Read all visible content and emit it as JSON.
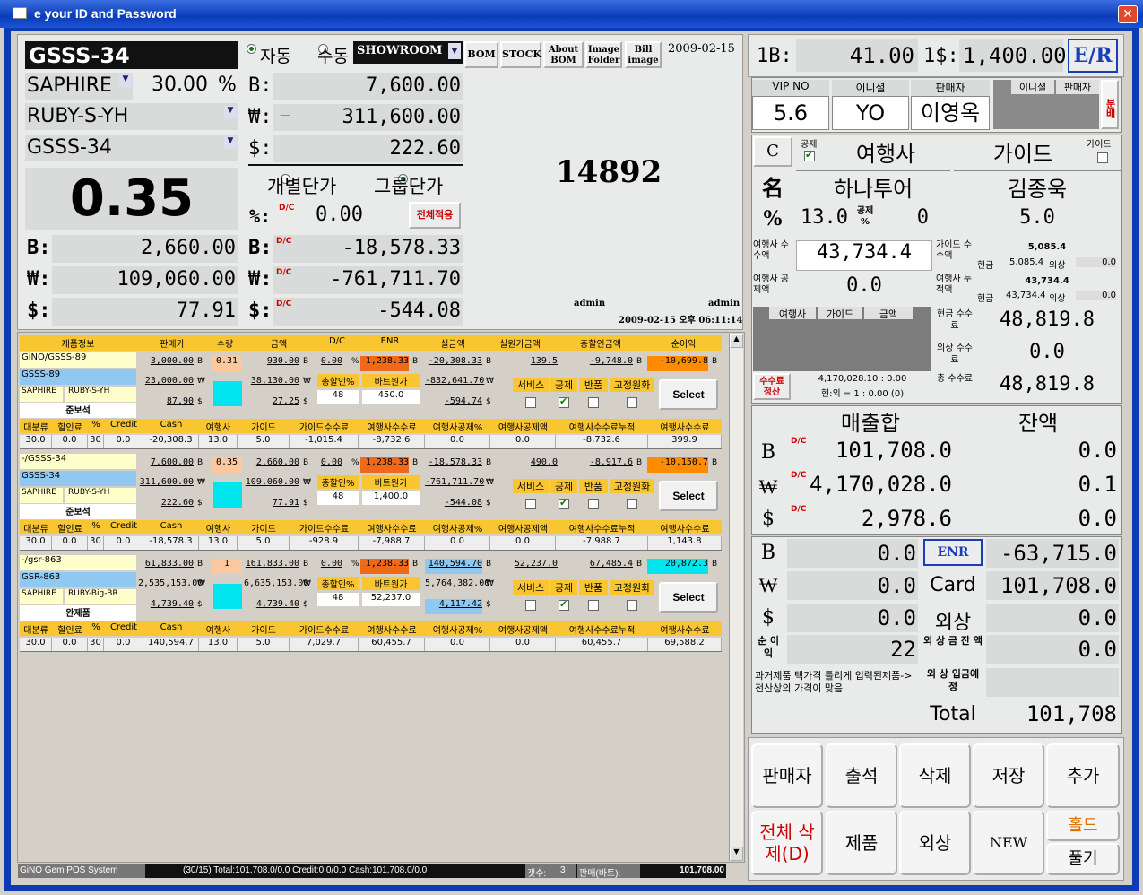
{
  "window": {
    "title": "e your ID and Password",
    "close": "✕"
  },
  "product": {
    "code": "GSSS-34",
    "mode_auto": "자동",
    "mode_manual": "수동",
    "showroom": "SHOWROOM",
    "btn_bom": "BOM",
    "btn_stock": "STOCK",
    "btn_about": "About BOM",
    "btn_image_folder": "Image Folder",
    "btn_bill_image": "Bill image",
    "date": "2009-02-15",
    "stone": "SAPHIRE",
    "pct": "30.00",
    "pct_sign": "%",
    "model": "RUBY-S-YH",
    "code2": "GSSS-34",
    "b_label": "B:",
    "w_label": "₩:",
    "d_label": "$:",
    "price_b": "7,600.00",
    "price_w_prefix": "—",
    "price_w": "311,600.00",
    "price_d": "222.60",
    "big_rate": "0.35",
    "individual": "개별단가",
    "group": "그룹단가",
    "pct_label": "%:",
    "dc": "D/C",
    "dc_value": "0.00",
    "apply_all": "전체적용",
    "big_id": "14892",
    "sub_b": "2,660.00",
    "sub_w": "109,060.00",
    "sub_d": "77.91",
    "dc_b": "-18,578.33",
    "dc_w": "-761,711.70",
    "dc_d": "-544.08",
    "admin1": "admin",
    "admin2": "admin",
    "timestamp": "2009-02-15 오후 06:11:14"
  },
  "table": {
    "headers": [
      "제품정보",
      "판매가",
      "수량",
      "금액",
      "D/C",
      "ENR",
      "실금액",
      "실원가금액",
      "총할인금액",
      "순이익"
    ],
    "sub_headers": [
      "대분류",
      "할인료",
      "%",
      "Credit",
      "Cash",
      "여행사",
      "가이드",
      "가이드수수료",
      "여행사수수료",
      "여행사공제%",
      "여행사공제액",
      "여행사수수료누적",
      "여행사수수료"
    ],
    "flags": [
      "서비스",
      "공제",
      "반품",
      "고정원화"
    ],
    "disc_label": "총할인%",
    "bath_label": "바트원가",
    "select": "Select",
    "items": [
      {
        "name": "GiNO/GSSS-89",
        "code": "GSSS-89",
        "stone": "SAPHIRE",
        "model": "RUBY-S-YH",
        "type": "준보석",
        "price_b": "3,000.00",
        "price_w": "23,000.00",
        "price_d": "87.90",
        "qty": "0.31",
        "amt_b": "930.00",
        "amt_w": "38,130.00",
        "amt_d": "27.25",
        "dc": "0.00",
        "enr": "1,238.33",
        "disc": "48",
        "bath": "450.0",
        "real_b": "-20,308.33",
        "real_w": "-832,641.70",
        "real_d": "-594.74",
        "cost": "139.5",
        "total_disc": "-9,748.0",
        "profit": "-10,699.8",
        "sub": [
          "30.0",
          "0.0",
          "30",
          "0.0",
          "-20,308.3",
          "13.0",
          "5.0",
          "-1,015.4",
          "-8,732.6",
          "0.0",
          "0.0",
          "-8,732.6",
          "399.9"
        ]
      },
      {
        "name": "-/GSSS-34",
        "code": "GSSS-34",
        "stone": "SAPHIRE",
        "model": "RUBY-S-YH",
        "type": "준보석",
        "price_b": "7,600.00",
        "price_w": "311,600.00",
        "price_d": "222.60",
        "qty": "0.35",
        "amt_b": "2,660.00",
        "amt_w": "109,060.00",
        "amt_d": "77.91",
        "dc": "0.00",
        "enr": "1,238.33",
        "disc": "48",
        "bath": "1,400.0",
        "real_b": "-18,578.33",
        "real_w": "-761,711.70",
        "real_d": "-544.08",
        "cost": "490.0",
        "total_disc": "-8,917.6",
        "profit": "-10,150.7",
        "sub": [
          "30.0",
          "0.0",
          "30",
          "0.0",
          "-18,578.3",
          "13.0",
          "5.0",
          "-928.9",
          "-7,988.7",
          "0.0",
          "0.0",
          "-7,988.7",
          "1,143.8"
        ]
      },
      {
        "name": "-/gsr-863",
        "code": "GSR-863",
        "stone": "SAPHIRE",
        "model": "RUBY-Big-BR",
        "type": "완제품",
        "price_b": "61,833.00",
        "price_w": "2,535,153.00",
        "price_d": "4,739.40",
        "qty": "1",
        "amt_b": "161,833.00",
        "amt_w": "6,635,153.00",
        "amt_d": "4,739.40",
        "dc": "0.00",
        "enr": "1,238.33",
        "disc": "48",
        "bath": "52,237.0",
        "real_b": "140,594.70",
        "real_w": "5,764,382.00",
        "real_d": "4,117.42",
        "cost": "52,237.0",
        "total_disc": "67,485.4",
        "profit": "20,872.3",
        "sub": [
          "30.0",
          "0.0",
          "30",
          "0.0",
          "140,594.7",
          "13.0",
          "5.0",
          "7,029.7",
          "60,455.7",
          "0.0",
          "0.0",
          "60,455.7",
          "69,588.2"
        ]
      }
    ]
  },
  "status": {
    "app": "GiNO Gem  POS System",
    "summary": "(30/15) Total:101,708.0/0.0 Credit:0.0/0.0 Cash:101,708.0/0.0",
    "count_label": "갯수:",
    "count": "3",
    "sales_label": "판매(바트):",
    "sales": "101,708.00"
  },
  "rate": {
    "b_label": "1B:",
    "b_value": "41.00",
    "d_label": "1$:",
    "d_value": "1,400.00",
    "er": "E/R"
  },
  "vip": {
    "vip_label": "VIP NO",
    "vip": "5.6",
    "initial_label": "이니셜",
    "initial": "YO",
    "seller_label": "판매자",
    "seller": "이영옥",
    "initial2": "이니셜",
    "seller2": "판매자",
    "split": "분배"
  },
  "agency": {
    "c": "C",
    "deduct": "공제",
    "agency_label": "여행사",
    "guide_label": "가이드",
    "guide_small": "가이드",
    "name_label": "名",
    "agency": "하나투어",
    "guide": "김종욱",
    "pct_label": "%",
    "agency_pct": "13.0",
    "deduct_pct_label": "공제 %",
    "deduct_pct": "0",
    "guide_pct": "5.0",
    "comm_label": "여행사 수수액",
    "comm": "43,734.4",
    "guide_comm_label": "가이드 수수액",
    "guide_comm": "5,085.4",
    "cash": "현금",
    "cash_val": "5,085.4",
    "foreign": "외상",
    "foreign_val": "0.0",
    "deduct_amt_label": "여행사 공제액",
    "deduct_amt": "0.0",
    "accum_label": "여행사 누적액",
    "accum": "43,734.4",
    "cash_val2": "43,734.4",
    "foreign_val2": "0.0",
    "tabs": [
      "여행사",
      "가이드",
      "금액"
    ],
    "cash_comm_label": "현금 수수료",
    "cash_comm": "48,819.8",
    "credit_comm_label": "외상 수수료",
    "credit_comm": "0.0",
    "settle": "수수료 정산",
    "settle_info1": "4,170,028.10 : 0.00",
    "settle_info2": "현:외 = 1 : 0.00 (0)",
    "total_comm_label": "총 수수료",
    "total_comm": "48,819.8"
  },
  "totals": {
    "sum_label": "매출합",
    "bal_label": "잔액",
    "b": "B",
    "w": "₩",
    "d": "$",
    "sum_b": "101,708.0",
    "sum_w": "4,170,028.0",
    "sum_d": "2,978.6",
    "bal_b": "0.0",
    "bal_w": "0.1",
    "bal_d": "0.0"
  },
  "pay": {
    "b": "0.0",
    "w": "0.0",
    "d": "0.0",
    "enr": "ENR",
    "enr_val": "-63,715.0",
    "card": "Card",
    "card_val": "101,708.0",
    "credit": "외상",
    "credit_val": "0.0",
    "profit_label": "순 이익",
    "profit": "22",
    "credit_bal_label": "외 상 금 잔 액",
    "credit_bal": "0.0",
    "note": "과거제품 택가격 틀리게 입력된제품->전산상의 가격이 맞음",
    "credit_due_label": "외 상 입금예정",
    "total_label": "Total",
    "total": "101,708"
  },
  "actions": {
    "seller": "판매자",
    "attend": "출석",
    "delete": "삭제",
    "save": "저장",
    "add": "추가",
    "delete_all": "전체 삭제(D)",
    "product": "제품",
    "credit": "외상",
    "new": "NEW",
    "hold": "홀드",
    "release": "풀기"
  },
  "colors": {
    "hdr": "#f9c530",
    "enr": "#ee6a1a",
    "profit": "#ff8c00",
    "cyan": "#00e5ee",
    "blue": "#8fc8f0",
    "green": "#0a7a0a"
  }
}
